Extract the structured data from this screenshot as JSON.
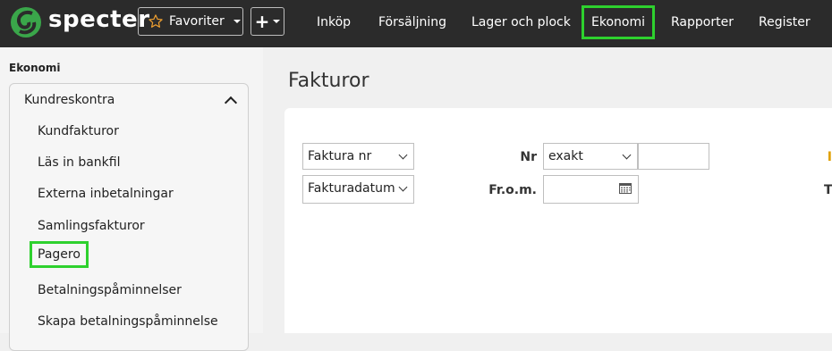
{
  "header": {
    "brand": "specter",
    "favorites_label": "Favoriter",
    "nav": [
      {
        "label": "Inköp"
      },
      {
        "label": "Försäljning"
      },
      {
        "label": "Lager och plock"
      },
      {
        "label": "Ekonomi",
        "highlighted": true
      },
      {
        "label": "Rapporter"
      },
      {
        "label": "Register"
      }
    ]
  },
  "sidebar": {
    "section_title": "Ekonomi",
    "group_label": "Kundreskontra",
    "items": [
      {
        "label": "Kundfakturor"
      },
      {
        "label": "Läs in bankfil"
      },
      {
        "label": "Externa inbetalningar"
      },
      {
        "label": "Samlingsfakturor"
      },
      {
        "label": "Pagero",
        "highlighted": true
      },
      {
        "label": "Betalningspåminnelser"
      },
      {
        "label": "Skapa betalningspåminnelse"
      }
    ]
  },
  "main": {
    "title": "Fakturor",
    "filters": {
      "field_select_1": "Faktura nr",
      "field_select_2": "Fakturadatum",
      "nr_label": "Nr",
      "match_select": "exakt",
      "from_label": "Fr.o.m.",
      "cut_label_1": "I",
      "cut_label_2": "T"
    }
  },
  "colors": {
    "navbar_bg": "#2b2b2b",
    "highlight": "#2ed12e",
    "logo_green": "#3aa64a",
    "star": "#f0a030"
  },
  "icons": [
    "specter-logo-icon",
    "star-icon",
    "plus-icon",
    "chevron-up-icon",
    "chevron-down-icon",
    "calendar-icon"
  ]
}
